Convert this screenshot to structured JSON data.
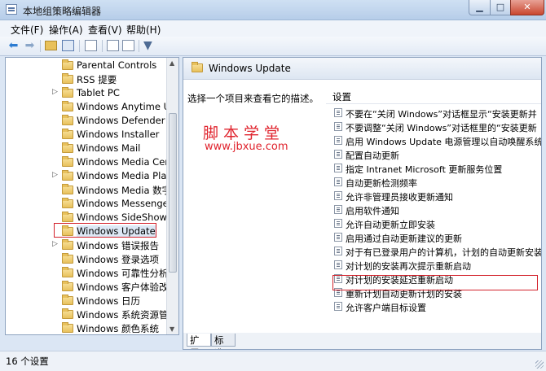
{
  "window": {
    "title": "本地组策略编辑器",
    "minimize_icon": "minimize-icon",
    "maximize_icon": "maximize-icon",
    "close_icon": "close-icon"
  },
  "menu": [
    "文件(F)",
    "操作(A)",
    "查看(V)",
    "帮助(H)"
  ],
  "tree": {
    "items": [
      {
        "label": "Parental Controls",
        "expander": ""
      },
      {
        "label": "RSS 提要",
        "expander": ""
      },
      {
        "label": "Tablet PC",
        "expander": "▷"
      },
      {
        "label": "Windows Anytime Upg",
        "expander": ""
      },
      {
        "label": "Windows Defender",
        "expander": ""
      },
      {
        "label": "Windows Installer",
        "expander": ""
      },
      {
        "label": "Windows Mail",
        "expander": ""
      },
      {
        "label": "Windows Media Cente",
        "expander": ""
      },
      {
        "label": "Windows Media Player",
        "expander": "▷"
      },
      {
        "label": "Windows Media 数字权",
        "expander": ""
      },
      {
        "label": "Windows Messenger",
        "expander": ""
      },
      {
        "label": "Windows SideShow",
        "expander": ""
      },
      {
        "label": "Windows Update",
        "expander": ""
      },
      {
        "label": "Windows 错误报告",
        "expander": "▷"
      },
      {
        "label": "Windows 登录选项",
        "expander": ""
      },
      {
        "label": "Windows 可靠性分析",
        "expander": ""
      },
      {
        "label": "Windows 客户体验改善i",
        "expander": ""
      },
      {
        "label": "Windows 日历",
        "expander": ""
      },
      {
        "label": "Windows 系统资源管理",
        "expander": ""
      },
      {
        "label": "Windows 颜色系统",
        "expander": ""
      }
    ]
  },
  "right": {
    "title": "Windows Update",
    "description": "选择一个项目来查看它的描述。",
    "watermark_cn": "脚本学堂",
    "watermark_url": "www.jbxue.com",
    "list_header": "设置",
    "settings": [
      "不要在“关闭 Windows”对话框显示“安装更新并",
      "不要调整“关闭 Windows”对话框里的“安装更新",
      "启用 Windows Update 电源管理以自动唤醒系统",
      "配置自动更新",
      "指定 Intranet Microsoft 更新服务位置",
      "自动更新检测频率",
      "允许非管理员接收更新通知",
      "启用软件通知",
      "允许自动更新立即安装",
      "启用通过自动更新建议的更新",
      "对于有已登录用户的计算机，计划的自动更新安装",
      "对计划的安装再次提示重新启动",
      "对计划的安装延迟重新启动",
      "重新计划自动更新计划的安装",
      "允许客户端目标设置"
    ],
    "tabs": [
      "扩展",
      "标准"
    ]
  },
  "status": "16 个设置"
}
